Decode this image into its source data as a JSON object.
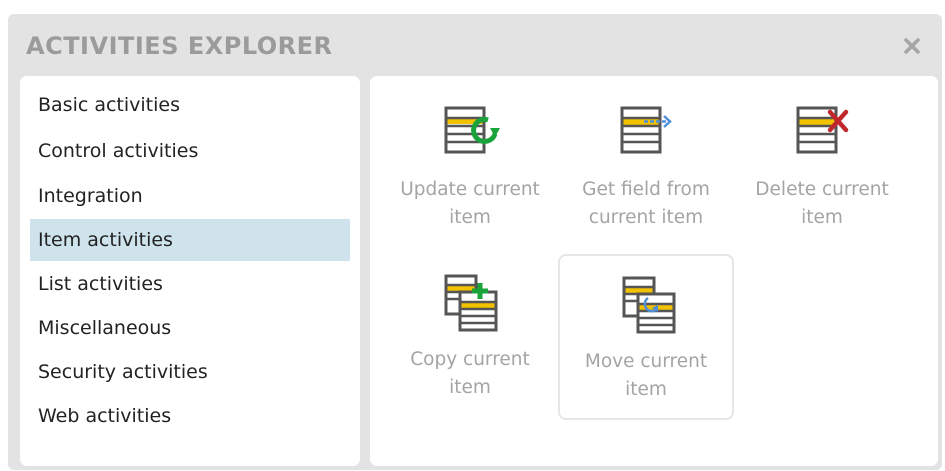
{
  "window": {
    "title": "ACTIVITIES EXPLORER"
  },
  "categories": [
    {
      "label": "Basic activities"
    },
    {
      "label": "Control activities"
    },
    {
      "label": "Integration"
    },
    {
      "label": "Item activities"
    },
    {
      "label": "List activities"
    },
    {
      "label": "Miscellaneous"
    },
    {
      "label": "Security activities"
    },
    {
      "label": "Web activities"
    }
  ],
  "selected_category": "Item activities",
  "activities": [
    {
      "label": "Update current\nitem",
      "icon": "update-item-icon"
    },
    {
      "label": "Get field from\ncurrent item",
      "icon": "get-field-icon"
    },
    {
      "label": "Delete current\nitem",
      "icon": "delete-item-icon"
    },
    {
      "label": "Copy current\nitem",
      "icon": "copy-item-icon"
    },
    {
      "label": "Move current\nitem",
      "icon": "move-item-icon"
    }
  ],
  "colors": {
    "selection": "#cfe3ed",
    "accent_yellow": "#f2c200",
    "green": "#1aa33a",
    "blue_arrow": "#4f8fd8",
    "red_x": "#c0282c"
  }
}
